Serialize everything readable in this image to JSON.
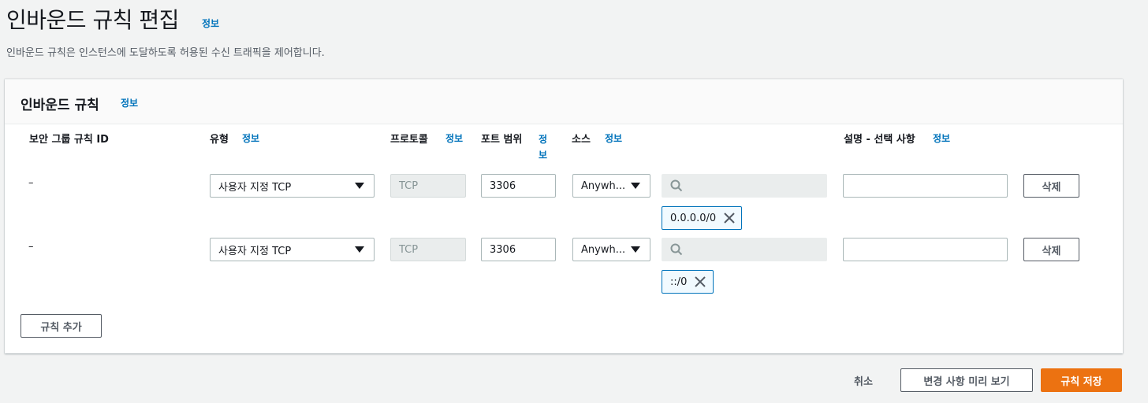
{
  "page": {
    "title": "인바운드 규칙 편집",
    "title_info": "정보",
    "description": "인바운드 규칙은 인스턴스에 도달하도록 허용된 수신 트래픽을 제어합니다."
  },
  "panel": {
    "title": "인바운드 규칙",
    "title_info": "정보",
    "columns": {
      "rule_id": "보안 그룹 규칙 ID",
      "type": "유형",
      "type_info": "정보",
      "protocol": "프로토콜",
      "protocol_info": "정보",
      "port_range": "포트 범위",
      "port_info": "정보",
      "source": "소스",
      "source_info": "정보",
      "description": "설명 - 선택 사항",
      "description_info": "정보"
    },
    "rules": [
      {
        "rule_id": "–",
        "type": "사용자 지정 TCP",
        "protocol": "TCP",
        "port_range": "3306",
        "source": "Anywh...",
        "source_search": "",
        "cidr": "0.0.0.0/0",
        "description": "",
        "delete_label": "삭제"
      },
      {
        "rule_id": "–",
        "type": "사용자 지정 TCP",
        "protocol": "TCP",
        "port_range": "3306",
        "source": "Anywh...",
        "source_search": "",
        "cidr": "::/0",
        "description": "",
        "delete_label": "삭제"
      }
    ],
    "add_rule_label": "규칙 추가"
  },
  "footer": {
    "cancel_label": "취소",
    "preview_label": "변경 사항 미리 보기",
    "save_label": "규칙 저장"
  },
  "colors": {
    "accent": "#0073bb",
    "primary_button": "#ec7211",
    "background": "#f2f3f3"
  }
}
